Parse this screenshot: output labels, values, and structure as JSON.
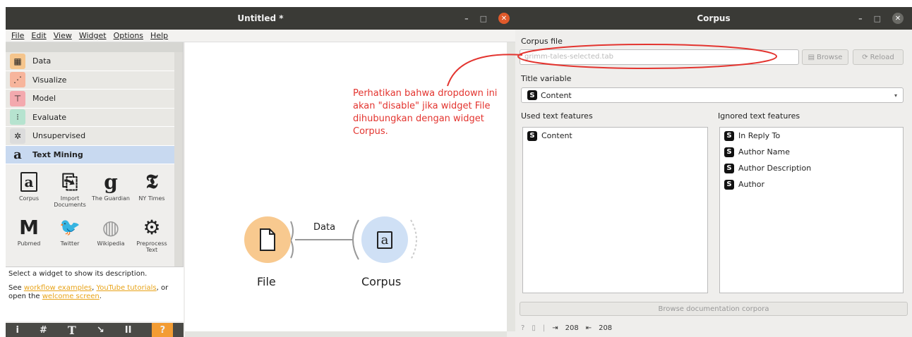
{
  "left_window": {
    "title": "Untitled *",
    "menu": [
      "File",
      "Edit",
      "View",
      "Widget",
      "Options",
      "Help"
    ],
    "categories": [
      {
        "label": "Data",
        "icon": "data-icon",
        "color": "#f5c58c"
      },
      {
        "label": "Visualize",
        "icon": "visualize-icon",
        "color": "#f7b59c"
      },
      {
        "label": "Model",
        "icon": "model-icon",
        "color": "#f3a9ae"
      },
      {
        "label": "Evaluate",
        "icon": "evaluate-icon",
        "color": "#b6e3cf"
      },
      {
        "label": "Unsupervised",
        "icon": "unsupervised-icon",
        "color": "#dcdcdc"
      },
      {
        "label": "Text Mining",
        "icon": "text-mining-icon",
        "color": "#c8d9f0"
      }
    ],
    "widgets": [
      {
        "label": "Corpus",
        "glyph": "a"
      },
      {
        "label": "Import Documents",
        "glyph": "⎘"
      },
      {
        "label": "The Guardian",
        "glyph": "g"
      },
      {
        "label": "NY Times",
        "glyph": "𝕿"
      },
      {
        "label": "Pubmed",
        "glyph": "M"
      },
      {
        "label": "Twitter",
        "glyph": "🐦"
      },
      {
        "label": "Wikipedia",
        "glyph": "◍"
      },
      {
        "label": "Preprocess Text",
        "glyph": "⚙"
      }
    ],
    "description": {
      "line1": "Select a widget to show its description.",
      "see": "See ",
      "link1": "workflow examples",
      "sep1": ", ",
      "link2": "YouTube tutorials",
      "or": ", or",
      "open": "open the ",
      "link3": "welcome screen",
      "end": "."
    },
    "bottom_bar": [
      "i",
      "#",
      "T",
      "↘",
      "II",
      "?"
    ],
    "canvas": {
      "link_label": "Data",
      "node_file": "File",
      "node_corpus": "Corpus"
    }
  },
  "annotation": "Perhatikan bahwa dropdown ini akan \"disable\" jika widget File dihubungkan dengan widget Corpus.",
  "right_window": {
    "title": "Corpus",
    "corpus_file_label": "Corpus file",
    "corpus_file_value": "grimm-tales-selected.tab",
    "browse_label": "Browse",
    "reload_label": "Reload",
    "title_variable_label": "Title variable",
    "title_variable_value": "Content",
    "used_label": "Used text features",
    "ignored_label": "Ignored text features",
    "used": [
      "Content"
    ],
    "ignored": [
      "In Reply To",
      "Author Name",
      "Author Description",
      "Author"
    ],
    "browse_doc_label": "Browse documentation corpora",
    "status_in": "208",
    "status_out": "208"
  },
  "colors": {
    "file_node": "#f8c98f",
    "corpus_node": "#cfe0f5",
    "annotation": "#e3342f",
    "close_button": "#e05a2b"
  }
}
